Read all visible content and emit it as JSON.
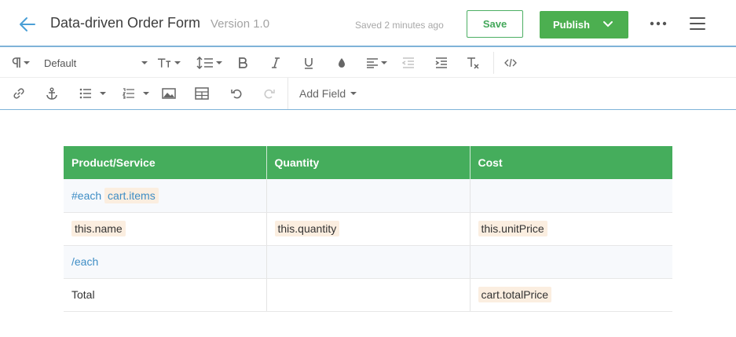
{
  "header": {
    "title": "Data-driven Order Form",
    "version": "Version 1.0",
    "saved_status": "Saved 2 minutes ago",
    "save_label": "Save",
    "publish_label": "Publish"
  },
  "toolbar": {
    "font_default": "Default",
    "add_field_label": "Add Field"
  },
  "table": {
    "headers": [
      "Product/Service",
      "Quantity",
      "Cost"
    ],
    "rows": {
      "each_start": {
        "keyword": "#each",
        "field": "cart.items"
      },
      "item": {
        "name": "this.name",
        "quantity": "this.quantity",
        "cost": "this.unitPrice"
      },
      "each_end": {
        "keyword": "/each"
      },
      "total": {
        "label": "Total",
        "cost": "cart.totalPrice"
      }
    }
  },
  "colors": {
    "accent_green": "#4caf50",
    "header_underline": "#7fb3d8",
    "keyword_blue": "#3e8dc5",
    "field_tag_bg": "#fbeee0"
  }
}
